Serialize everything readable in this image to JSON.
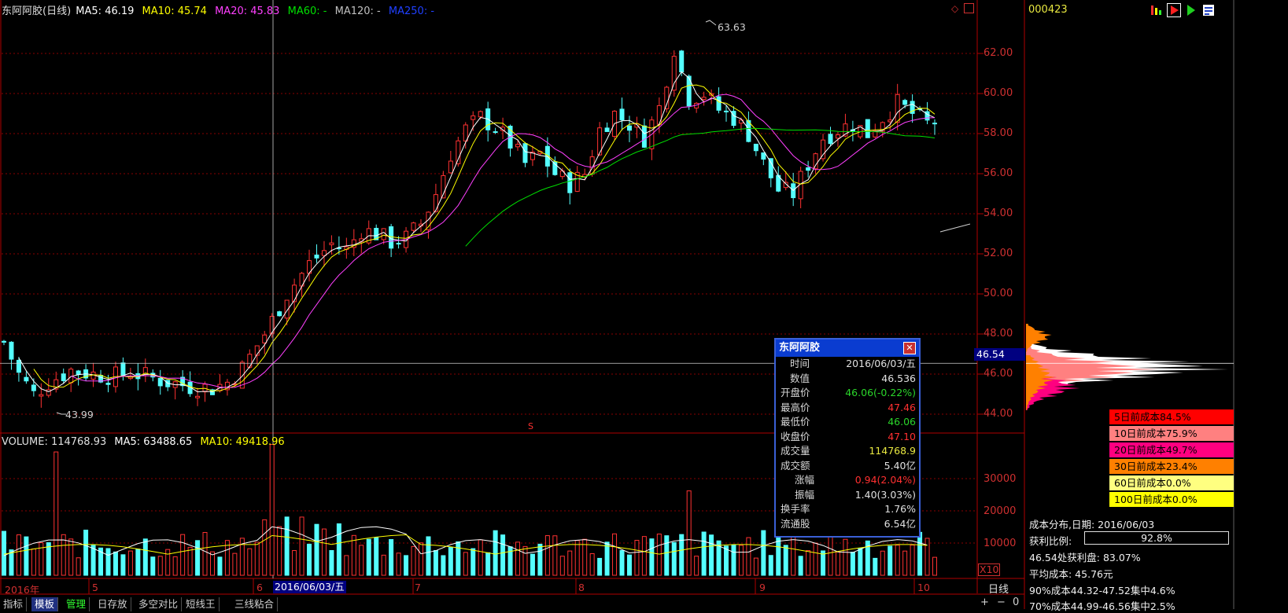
{
  "header": {
    "stock_title": "东阿阿胶(日线)",
    "ma5": "MA5: 46.19",
    "ma10": "MA10: 45.74",
    "ma20": "MA20: 45.83",
    "ma60": "MA60: -",
    "ma120": "MA120: -",
    "ma250": "MA250: -",
    "stock_code": "000423"
  },
  "volume_header": {
    "volume": "VOLUME: 114768.93",
    "ma5": "MA5: 63488.65",
    "ma10": "MA10: 49418.96"
  },
  "price_axis": [
    "62.00",
    "60.00",
    "58.00",
    "56.00",
    "54.00",
    "52.00",
    "50.00",
    "48.00",
    "46.00",
    "44.00"
  ],
  "price_cursor": "46.54",
  "volume_axis": [
    "30000",
    "20000",
    "10000"
  ],
  "volume_unit": "X10",
  "annotations": {
    "high": "63.63",
    "low": "43.99",
    "marker": "S"
  },
  "dates": {
    "year": "2016年",
    "m5": "5",
    "m6": "6",
    "selected": "2016/06/03/五",
    "m7": "7",
    "m8": "8",
    "m9": "9",
    "m10": "10"
  },
  "period": "日线",
  "tabs": [
    "指标",
    "模板",
    "管理",
    "日存放",
    "多空对比",
    "短线王",
    "三线粘合"
  ],
  "popup": {
    "title": "东阿阿胶",
    "rows": [
      {
        "label": "时间",
        "value": "2016/06/03/五",
        "color": "#e0e0e0"
      },
      {
        "label": "数值",
        "value": "46.536",
        "color": "#e0e0e0"
      },
      {
        "label": "开盘价",
        "value": "46.06(-0.22%)",
        "color": "#2ad62a"
      },
      {
        "label": "最高价",
        "value": "47.46",
        "color": "#ff3030"
      },
      {
        "label": "最低价",
        "value": "46.06",
        "color": "#2ad62a"
      },
      {
        "label": "收盘价",
        "value": "47.10",
        "color": "#ff3030"
      },
      {
        "label": "成交量",
        "value": "114768.9",
        "color": "#e8e840"
      },
      {
        "label": "成交额",
        "value": "5.40亿",
        "color": "#e0e0e0"
      },
      {
        "label": "涨幅",
        "value": "0.94(2.04%)",
        "color": "#ff3030"
      },
      {
        "label": "振幅",
        "value": "1.40(3.03%)",
        "color": "#e0e0e0"
      },
      {
        "label": "换手率",
        "value": "1.76%",
        "color": "#e0e0e0"
      },
      {
        "label": "流通股",
        "value": "6.54亿",
        "color": "#e0e0e0"
      }
    ]
  },
  "cost_legend": [
    {
      "label": "5日前成本84.5%",
      "color": "#ff0000"
    },
    {
      "label": "10日前成本75.9%",
      "color": "#ff8080"
    },
    {
      "label": "20日前成本49.7%",
      "color": "#ff0080"
    },
    {
      "label": "30日前成本23.4%",
      "color": "#ff8000"
    },
    {
      "label": "60日前成本0.0%",
      "color": "#ffff80"
    },
    {
      "label": "100日前成本0.0%",
      "color": "#ffff00"
    }
  ],
  "cost_info": {
    "title": "成本分布,日期: 2016/06/03",
    "profit_label": "获利比例:",
    "profit_value": "92.8%",
    "profit_ratio": 0.928,
    "price_profit": "46.54处获利盘: 83.07%",
    "avg_cost": "平均成本: 45.76元",
    "cost90": "90%成本44.32-47.52集中4.6%",
    "cost70": "70%成本44.99-46.56集中2.5%"
  },
  "colors": {
    "up": "#ff3232",
    "down": "#54ffff",
    "ma5": "#ffffff",
    "ma10": "#ffff00",
    "ma20": "#ff40ff",
    "ma60": "#00e000",
    "grid": "#8a0000"
  }
}
